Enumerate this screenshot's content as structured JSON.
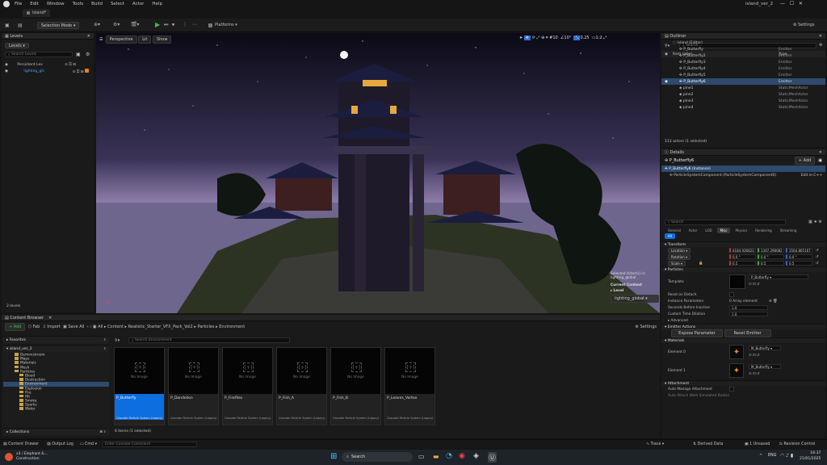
{
  "app": {
    "menu": [
      "File",
      "Edit",
      "Window",
      "Tools",
      "Build",
      "Select",
      "Actor",
      "Help"
    ],
    "project": "island_ver_2",
    "tab": "island*"
  },
  "toolbar": {
    "selection_mode": "Selection Mode",
    "platforms": "Platforms",
    "settings": "Settings"
  },
  "levels": {
    "title": "Levels",
    "dropdown": "Levels",
    "search_placeholder": "Search Levels",
    "items": [
      {
        "name": "Persistent Lev"
      },
      {
        "name": "lighting_glc"
      }
    ],
    "count": "2 levels"
  },
  "viewport": {
    "view": "Perspective",
    "lit": "Lit",
    "show": "Show",
    "grid": "10",
    "angle": "10°",
    "scale": "0.25",
    "cam": "1:2",
    "overlay": {
      "selected": "Selected Actor(s) in:",
      "level_name": "lighting_global",
      "current_context": "Current Context",
      "level": "Level",
      "level_value": "lighting_global"
    }
  },
  "outliner": {
    "title": "Outliner",
    "search_placeholder": "Search...",
    "col_label": "Item Label",
    "col_type": "Type",
    "root": "island (Editor)",
    "rows": [
      {
        "label": "P_Butterfly",
        "type": "Emitter"
      },
      {
        "label": "P_Butterfly2",
        "type": "Emitter"
      },
      {
        "label": "P_Butterfly3",
        "type": "Emitter"
      },
      {
        "label": "P_Butterfly4",
        "type": "Emitter"
      },
      {
        "label": "P_Butterfly5",
        "type": "Emitter"
      },
      {
        "label": "P_Butterfly6",
        "type": "Emitter"
      },
      {
        "label": "pine1",
        "type": "StaticMeshActor"
      },
      {
        "label": "pine2",
        "type": "StaticMeshActor"
      },
      {
        "label": "pine3",
        "type": "StaticMeshActor"
      },
      {
        "label": "pine4",
        "type": "StaticMeshActor"
      }
    ],
    "status": "113 actors (1 selected)"
  },
  "details": {
    "title": "Details",
    "actor": "P_Butterfly6",
    "add": "+ Add",
    "instance": "P_Butterfly6 (Instance)",
    "component": "ParticleSystemComponent (ParticleSystemComponent0)",
    "edit": "Edit in C++",
    "search_placeholder": "Search",
    "tabs": [
      "General",
      "Actor",
      "LOD",
      "Misc",
      "Physics",
      "Rendering",
      "Streaming"
    ],
    "all_tab": "All",
    "transform": {
      "title": "Transform",
      "location": "Location",
      "rotation": "Rotation",
      "scale": "Scale",
      "loc": [
        "4184.936823",
        "1307.298082",
        "3564.865167"
      ],
      "rot": [
        "0.0 °",
        "0.0 °",
        "0.0 °"
      ],
      "scl": [
        "0.5",
        "0.5",
        "0.5"
      ]
    },
    "particles": {
      "title": "Particles",
      "template": "Template",
      "template_value": "P_Butterfly",
      "reset_on_detach": "Reset on Detach",
      "instance_params": "Instance Parameters",
      "instance_value": "0 Array element",
      "seconds_before_inactive": "Seconds Before Inactive",
      "sbi_value": "1.0",
      "custom_time_dilation": "Custom Time Dilation",
      "ctd_value": "1.0"
    },
    "advanced": "Advanced",
    "emitter_actions": {
      "title": "Emitter Actions",
      "expose": "Expose Parameter",
      "reset": "Reset Emitter"
    },
    "materials": {
      "title": "Materials",
      "el0": "Element 0",
      "el1": "Element 1",
      "mat0": "M_Butterfly",
      "mat1": "M_Butterfly"
    },
    "attachment": {
      "title": "Attachment",
      "auto_manage": "Auto Manage Attachment",
      "auto_attach": "Auto Attach Weld Simulated Bodies"
    }
  },
  "content_browser": {
    "title": "Content Browser",
    "add": "+ Add",
    "fab": "Fab",
    "import": "Import",
    "save_all": "Save All",
    "path": [
      "All",
      "Content",
      "Realistic_Starter_VFX_Pack_Vol2",
      "Particles",
      "Environment"
    ],
    "settings": "Settings",
    "favorites": "Favorites",
    "project": "island_ver_2",
    "search_placeholder": "Search Environment",
    "tree": [
      "Demonstroom",
      "Maps",
      "Materials",
      "Mesh",
      "Particles",
      "Blood",
      "Destruction",
      "Environment",
      "Explosion",
      "Fire",
      "Hit",
      "Smoke",
      "Sparks",
      "Water"
    ],
    "assets": [
      {
        "name": "P_Butterfly",
        "kind": "Cascade Particle System (Legacy)"
      },
      {
        "name": "P_Dandelion",
        "kind": "Cascade Particle System (Legacy)"
      },
      {
        "name": "P_Fireflies",
        "kind": "Cascade Particle System (Legacy)"
      },
      {
        "name": "P_Fish_A",
        "kind": "Cascade Particle System (Legacy)"
      },
      {
        "name": "P_Fish_B",
        "kind": "Cascade Particle System (Legacy)"
      },
      {
        "name": "P_Leaves_Vortex",
        "kind": "Cascade Particle System (Legacy)"
      }
    ],
    "no_image": "No Image",
    "count": "6 items (1 selected)",
    "collections": "Collections"
  },
  "statusbar": {
    "content_drawer": "Content Drawer",
    "output_log": "Output Log",
    "cmd": "Cmd",
    "console_placeholder": "Enter Console Command",
    "trace": "Trace",
    "derived": "Derived Data",
    "unsaved": "1 Unsaved",
    "revision": "Revision Control"
  },
  "taskbar": {
    "weather_title": "x3 / Elephant &...",
    "weather_sub": "Construction",
    "search": "Search",
    "lang": "ENG",
    "time": "16:37",
    "date": "21/01/2025"
  }
}
